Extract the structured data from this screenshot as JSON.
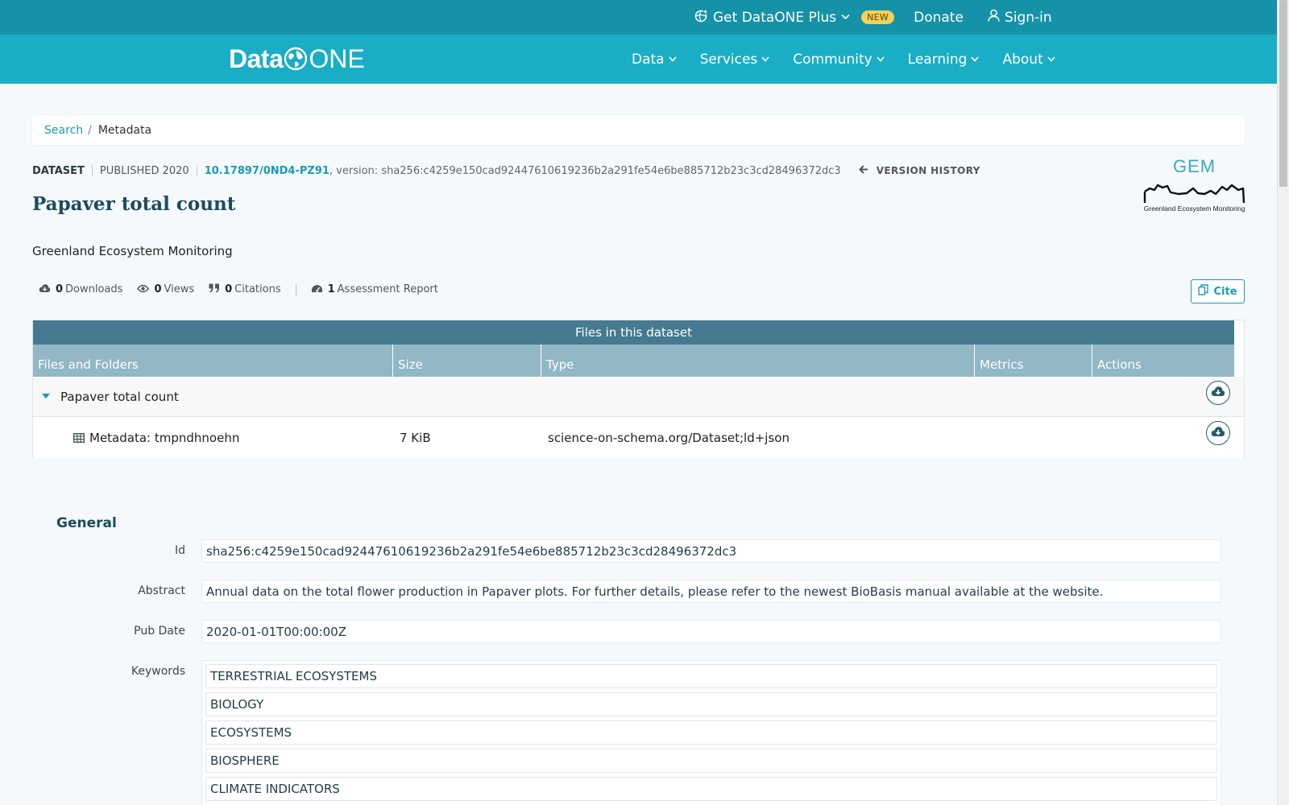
{
  "topbar": {
    "plus_label": "Get DataONE Plus",
    "new_badge": "NEW",
    "donate": "Donate",
    "signin": "Sign-in"
  },
  "logo": {
    "text_data": "Data",
    "text_one": "ONE"
  },
  "nav": {
    "items": [
      {
        "label": "Data"
      },
      {
        "label": "Services"
      },
      {
        "label": "Community"
      },
      {
        "label": "Learning"
      },
      {
        "label": "About"
      }
    ]
  },
  "breadcrumb": {
    "search": "Search",
    "sep": "/",
    "current": "Metadata"
  },
  "citation": {
    "type": "DATASET",
    "published": "PUBLISHED 2020",
    "doi": "10.17897/0ND4-PZ91",
    "version": ", version: sha256:c4259e150cad92447610619236b2a291fe54e6be885712b23c3cd28496372dc3",
    "version_history": "VERSION HISTORY"
  },
  "gem_logo": {
    "title": "GEM",
    "subtitle": "Greenland Ecosystem Monitoring"
  },
  "title": "Papaver total count",
  "creator": "Greenland Ecosystem Monitoring",
  "metrics": {
    "downloads_count": "0",
    "downloads_label": "Downloads",
    "views_count": "0",
    "views_label": "Views",
    "citations_count": "0",
    "citations_label": "Citations",
    "assessment_count": "1",
    "assessment_label": "Assessment Report"
  },
  "cite_button": "Cite",
  "files": {
    "heading": "Files in this dataset",
    "columns": [
      "Files and Folders",
      "Size",
      "Type",
      "Metrics",
      "Actions"
    ],
    "folder": {
      "name": "Papaver total count"
    },
    "file": {
      "name": "Metadata: tmpndhnoehn",
      "size": "7 KiB",
      "type": "science-on-schema.org/Dataset;ld+json"
    }
  },
  "general": {
    "heading": "General",
    "id_label": "Id",
    "id_value": "sha256:c4259e150cad92447610619236b2a291fe54e6be885712b23c3cd28496372dc3",
    "abstract_label": "Abstract",
    "abstract_value": "Annual data on the total flower production in Papaver plots. For further details, please refer to the newest BioBasis manual available at the website.",
    "pubdate_label": "Pub Date",
    "pubdate_value": "2020-01-01T00:00:00Z",
    "keywords_label": "Keywords",
    "keywords": [
      "TERRESTRIAL ECOSYSTEMS",
      "BIOLOGY",
      "ECOSYSTEMS",
      "BIOSPHERE",
      "CLIMATE INDICATORS"
    ]
  },
  "colors": {
    "topbar": "#1592a8",
    "navbar": "#19aec6",
    "accent": "#1a9bb2",
    "table_head": "#457a90",
    "table_cols": "#92b7c5"
  },
  "icons": {
    "plus": "globe-plus-icon",
    "signin": "user-icon",
    "downloads": "cloud-download-icon",
    "views": "eye-icon",
    "citations": "quote-icon",
    "assessment": "gauge-icon",
    "cite": "copy-icon",
    "folder_toggle": "caret-down-icon",
    "file": "table-icon",
    "download_action": "cloud-download-circle-icon",
    "version_history": "arrow-left-icon"
  }
}
